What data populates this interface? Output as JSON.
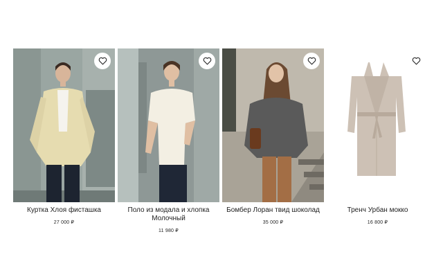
{
  "products": [
    {
      "title": "Куртка Хлоя фисташка",
      "price": "27 000 ₽",
      "image": "woman in pistachio cotton jacket"
    },
    {
      "title": "Поло из модала и хлопка Молочный",
      "price": "11 980 ₽",
      "image": "woman in milk knit polo"
    },
    {
      "title": "Бомбер Лоран твид шоколад",
      "price": "35 000 ₽",
      "image": "woman in tweed bomber on stairs"
    },
    {
      "title": "Тренч Урбан мокко",
      "price": "16 800 ₽",
      "image": "mocha trench coat product shot"
    }
  ],
  "icons": {
    "favorite": "heart-outline-icon"
  },
  "colors": {
    "text": "#222222",
    "background": "#ffffff"
  }
}
